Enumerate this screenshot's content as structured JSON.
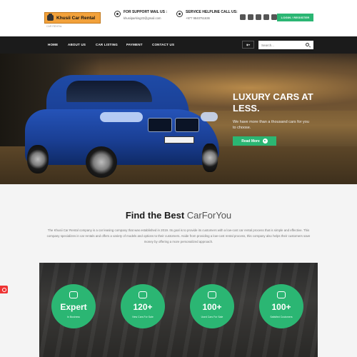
{
  "header": {
    "logo_text": "Khusii Car Rental",
    "logo_tagline": "CAR RENTAL",
    "mail_label": "FOR SUPPORT MAIL US :",
    "mail_value": "khusiiparking22@gmail.com",
    "phone_label": "SERVICE HELPLINE CALL US:",
    "phone_value": "+977 9840751636",
    "social_icons": [
      "facebook-icon",
      "twitter-icon",
      "linkedin-icon",
      "google-plus-icon",
      "instagram-icon"
    ],
    "login_label": "LOGIN / REGISTER"
  },
  "nav": {
    "items": [
      {
        "label": "HOME"
      },
      {
        "label": "ABOUT US"
      },
      {
        "label": "CAR LISTING"
      },
      {
        "label": "PAYMENT"
      },
      {
        "label": "CONTACT US"
      }
    ],
    "language_icon": "globe-icon",
    "search_placeholder": "Search..."
  },
  "hero": {
    "title": "LUXURY CARS AT LESS.",
    "subtitle": "We have more than a thousand cars for you to choose.",
    "button_label": "Read More"
  },
  "about": {
    "title_bold": "Find the Best",
    "title_light": "CarForYou",
    "text": "The Khusii Car Rental company is a car leasing company that was established in 2019. Its goal is to provide its customers with a low-cost car rental process that is simple and effective. This company specializes in car rentals and offers a variety of models and options to their customers. Aside from providing a low-cost rental process, this company also helps their customers save money by offering a more personalized approach."
  },
  "stats": [
    {
      "value": "Expert",
      "label": "In Business",
      "icon": "calendar-icon"
    },
    {
      "value": "120+",
      "label": "New Cars For Sale",
      "icon": "car-icon"
    },
    {
      "value": "100+",
      "label": "Used Cars For Sale",
      "icon": "car-icon"
    },
    {
      "value": "100+",
      "label": "Satisfied Customers",
      "icon": "user-icon"
    }
  ],
  "colors": {
    "accent": "#2bb673",
    "nav_bg": "#1b1b1b",
    "logo_bg": "#f2a13a"
  }
}
